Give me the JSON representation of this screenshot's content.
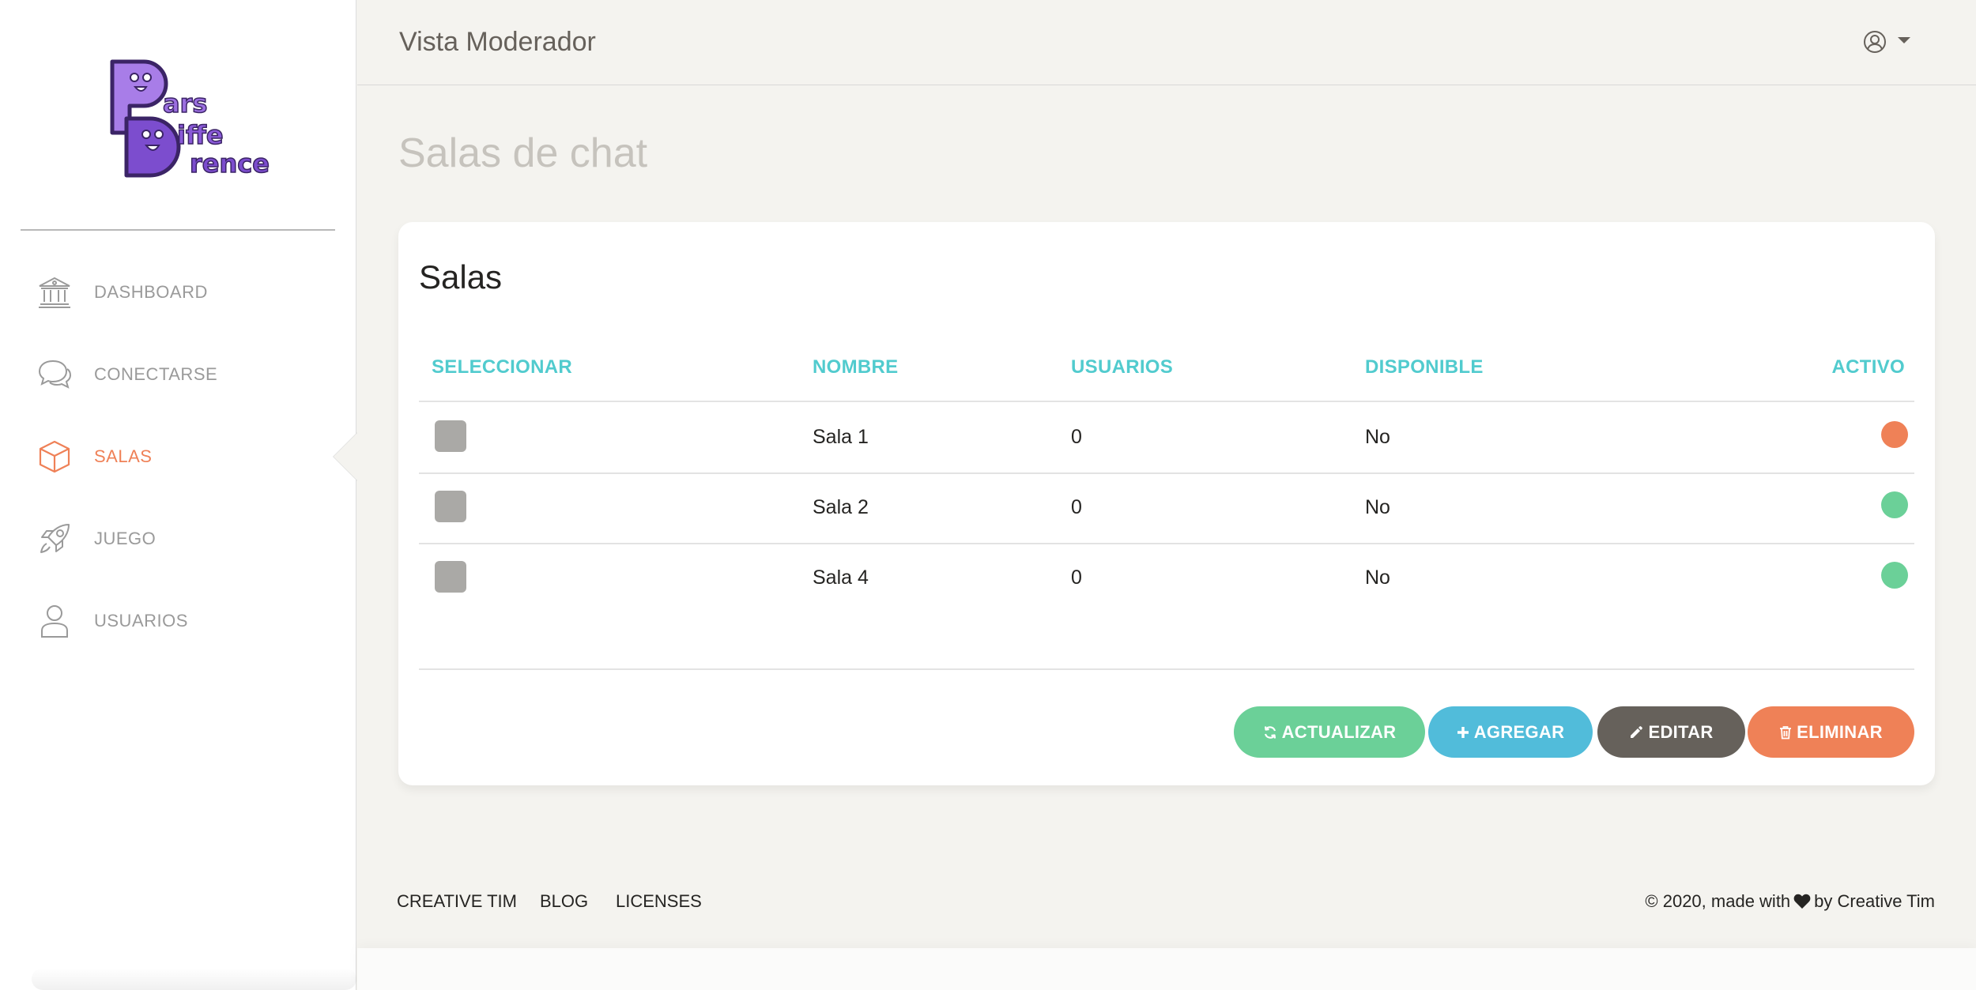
{
  "app": {
    "logo_text": "ParsDiffeDrence",
    "window_title": "Vista Moderador"
  },
  "sidebar": {
    "items": [
      {
        "label": "DASHBOARD",
        "icon": "bank-icon",
        "active": false
      },
      {
        "label": "CONECTARSE",
        "icon": "chat-bubbles-icon",
        "active": false
      },
      {
        "label": "SALAS",
        "icon": "box-icon",
        "active": true
      },
      {
        "label": "JUEGO",
        "icon": "rocket-icon",
        "active": false
      },
      {
        "label": "USUARIOS",
        "icon": "user-icon",
        "active": false
      }
    ]
  },
  "header": {
    "title": "Vista Moderador",
    "user_icon": "user-circle-icon"
  },
  "page": {
    "heading": "Salas de chat"
  },
  "card": {
    "title": "Salas",
    "columns": [
      "SELECCIONAR",
      "NOMBRE",
      "USUARIOS",
      "DISPONIBLE",
      "ACTIVO"
    ],
    "rows": [
      {
        "nombre": "Sala 1",
        "usuarios": "0",
        "disponible": "No",
        "activo": false
      },
      {
        "nombre": "Sala 2",
        "usuarios": "0",
        "disponible": "No",
        "activo": true
      },
      {
        "nombre": "Sala 4",
        "usuarios": "0",
        "disponible": "No",
        "activo": true
      }
    ],
    "buttons": {
      "refresh": "ACTUALIZAR",
      "add": "AGREGAR",
      "edit": "EDITAR",
      "delete": "ELIMINAR"
    }
  },
  "footer": {
    "links": [
      "CREATIVE TIM",
      "BLOG",
      "LICENSES"
    ],
    "copyright_prefix": "© 2020, made with",
    "copyright_suffix": "by Creative Tim"
  },
  "colors": {
    "accent_teal": "#51cbce",
    "active_orange": "#ef8157",
    "success_green": "#6bd098",
    "info_blue": "#51bcda",
    "dark_gray": "#66615b",
    "logo_purple": "#7c4dce"
  }
}
